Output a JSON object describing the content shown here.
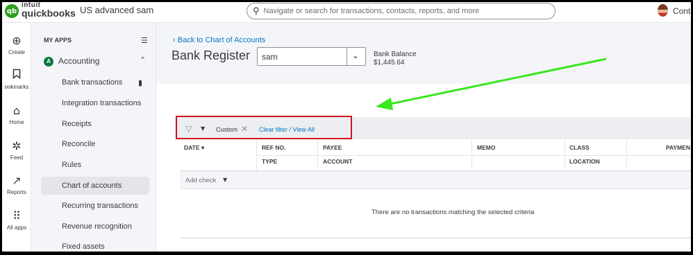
{
  "topbar": {
    "logo": "qb",
    "brand_line1": "intuit",
    "brand_line2": "quickbooks",
    "company": "US advanced sam",
    "search_placeholder": "Navigate or search for transactions, contacts, reports, and more",
    "contact_label": "Cont"
  },
  "rail": [
    {
      "icon": "plus-circle-icon",
      "glyph": "⊕",
      "label": "Create"
    },
    {
      "icon": "bookmark-icon",
      "glyph": "⌑",
      "label": "ookmarks"
    },
    {
      "icon": "home-icon",
      "glyph": "⌂",
      "label": "Home"
    },
    {
      "icon": "feed-icon",
      "glyph": "✲",
      "label": "Feed"
    },
    {
      "icon": "reports-icon",
      "glyph": "↗",
      "label": "Reports"
    },
    {
      "icon": "all-apps-icon",
      "glyph": "⠿",
      "label": "All apps"
    }
  ],
  "nav": {
    "section": "MY APPS",
    "app_icon": "A",
    "app": "Accounting",
    "items": [
      {
        "label": "Bank transactions"
      },
      {
        "label": "Integration transactions"
      },
      {
        "label": "Receipts"
      },
      {
        "label": "Reconcile"
      },
      {
        "label": "Rules"
      },
      {
        "label": "Chart of accounts"
      },
      {
        "label": "Recurring transactions"
      },
      {
        "label": "Revenue recognition"
      },
      {
        "label": "Fixed assets"
      }
    ]
  },
  "register": {
    "back_link": "Back to Chart of Accounts",
    "title": "Bank Register",
    "account": "sam",
    "balance_label": "Bank Balance",
    "balance_value": "$1,445.64"
  },
  "filter": {
    "custom": "Custom",
    "clear_link": "Clear filter / View All"
  },
  "table": {
    "headers": {
      "date": "DATE ▾",
      "ref_no": "REF NO.",
      "type": "TYPE",
      "payee": "PAYEE",
      "account": "ACCOUNT",
      "memo": "MEMO",
      "class": "CLASS",
      "location": "LOCATION",
      "payment": "PAYMEN"
    },
    "add_check": "Add check",
    "empty_message": "There are no transactions matching the selected criteria"
  },
  "colors": {
    "brand_green": "#2ca01c",
    "link_blue": "#0077c5",
    "highlight_red": "#d0121b",
    "annotation_arrow": "#39e61f"
  }
}
